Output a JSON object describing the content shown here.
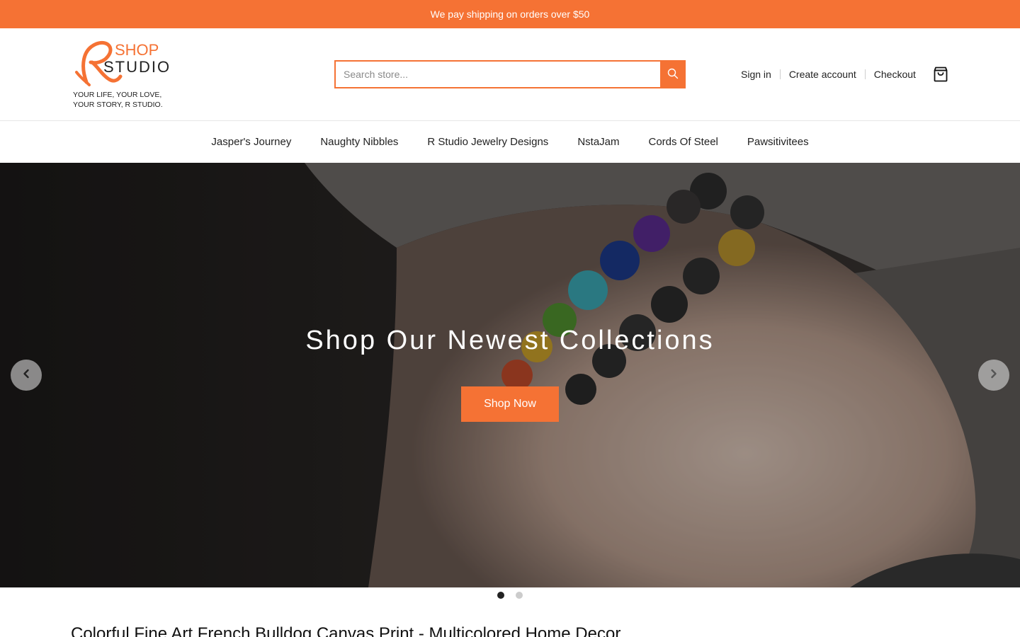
{
  "promo": {
    "text": "We pay shipping on orders over $50"
  },
  "logo": {
    "shop": "SHOP",
    "studio": "STUDIO",
    "tagline_line1": "YOUR LIFE, YOUR LOVE,",
    "tagline_line2": "YOUR STORY, R STUDIO."
  },
  "search": {
    "placeholder": "Search store...",
    "value": ""
  },
  "account": {
    "sign_in": "Sign in",
    "create_account": "Create account",
    "checkout": "Checkout"
  },
  "nav": {
    "items": [
      {
        "label": "Jasper's Journey"
      },
      {
        "label": "Naughty Nibbles"
      },
      {
        "label": "R Studio Jewelry Designs"
      },
      {
        "label": "NstaJam"
      },
      {
        "label": "Cords Of Steel"
      },
      {
        "label": "Pawsitivitees"
      }
    ]
  },
  "hero": {
    "title": "Shop Our Newest Collections",
    "button": "Shop Now",
    "slides_total": 2,
    "active_slide": 1
  },
  "product": {
    "heading": "Colorful Fine Art French Bulldog Canvas Print - Multicolored Home Decor"
  },
  "colors": {
    "accent": "#f57234",
    "text": "#222222"
  },
  "icons": {
    "search": "search-icon",
    "cart": "shopping-bag-icon",
    "prev": "chevron-left-icon",
    "next": "chevron-right-icon"
  }
}
